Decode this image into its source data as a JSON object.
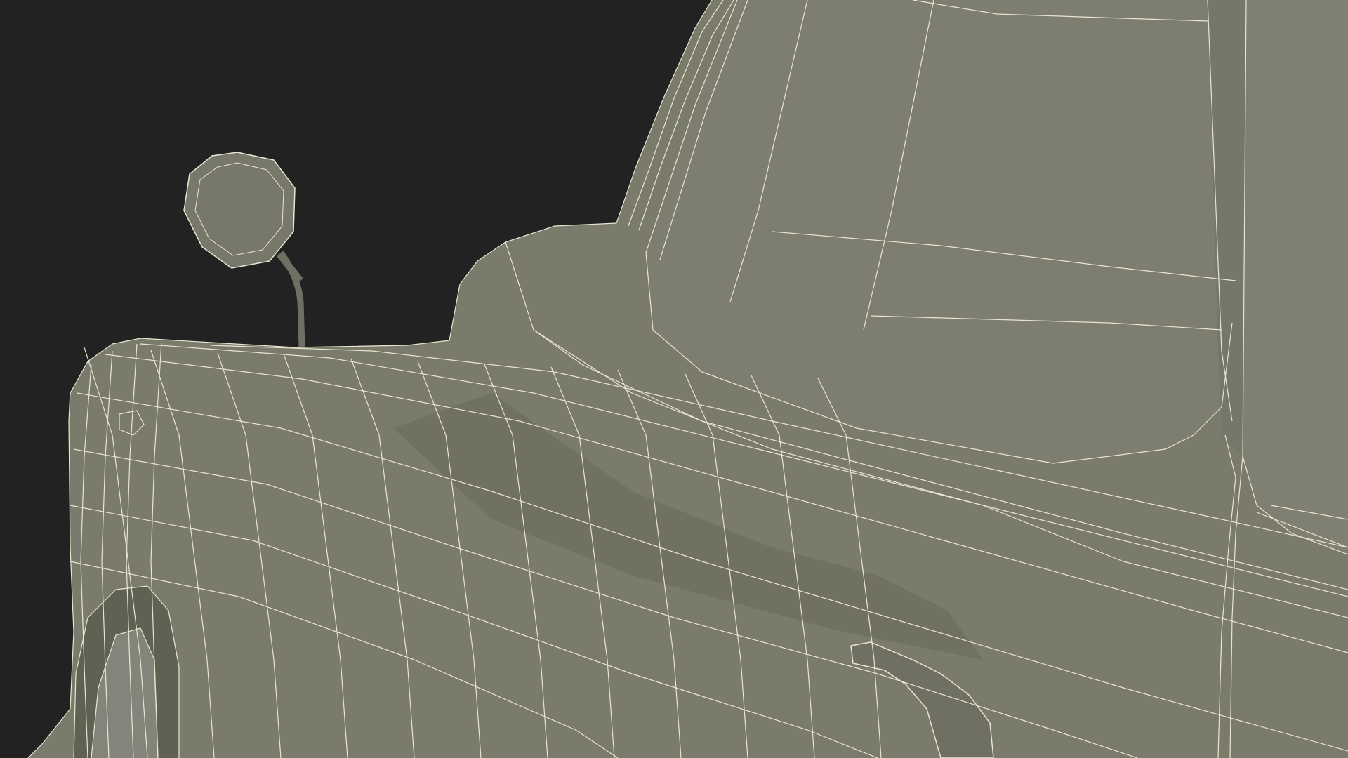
{
  "scene": {
    "background_color": "#222222",
    "body_color": "#7a7b6a",
    "body_shadow_color": "#666857",
    "glass_color": "#7d7e6f",
    "wire_color": "#e8e6d2",
    "subject": "wireframe-vehicle-front-quarter"
  }
}
